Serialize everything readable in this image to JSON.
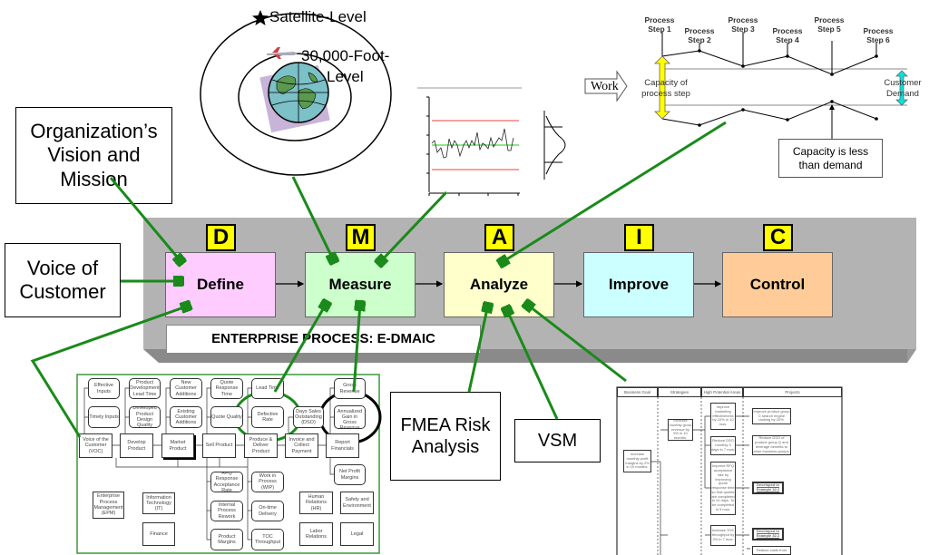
{
  "levels": {
    "satellite": "Satellite-Level",
    "foot_line1": "30,000-Foot-",
    "foot_line2": "Level"
  },
  "left_boxes": {
    "vision": "Organization’s Vision and Mission",
    "voice": "Voice of Customer"
  },
  "dmaic": {
    "phases": [
      {
        "letter": "D",
        "label": "Define",
        "color": "#ffccff"
      },
      {
        "letter": "M",
        "label": "Measure",
        "color": "#ccffcc"
      },
      {
        "letter": "A",
        "label": "Analyze",
        "color": "#ffffcc"
      },
      {
        "letter": "I",
        "label": "Improve",
        "color": "#ccffff"
      },
      {
        "letter": "C",
        "label": "Control",
        "color": "#ffcc99"
      }
    ],
    "banner": "ENTERPRISE PROCESS: E-DMAIC",
    "panel_color": "#b3b3b3"
  },
  "capacity": {
    "steps": [
      "Process Step 1",
      "Process Step 2",
      "Process Step 3",
      "Process Step 4",
      "Process Step 5",
      "Process Step 6"
    ],
    "work": "Work",
    "capacity_label": "Capacity of process step",
    "demand_label": "Customer Demand",
    "callout": "Capacity is less than demand"
  },
  "tools": {
    "fmea": "FMEA Risk Analysis",
    "vsm": "VSM"
  },
  "arrow_color": "#1a8a1a",
  "flowchart": {
    "boxes": [
      "Effective Inputs",
      "Timely Inputs",
      "Product Development Lead Time",
      "Developed Product Design Quality",
      "New Customer Additions",
      "Existing Customer Additions",
      "Quote Response Time",
      "Quote Quality",
      "Lead Time",
      "Defective Rate",
      "Days Sales Outstanding (DSO)",
      "Gross Revenue",
      "Percent Annualized Gain in Gross Revenue",
      "Voice of the Customer (VOC)",
      "Develop Product",
      "Market Product",
      "Sell Product",
      "Produce & Deliver Product",
      "Invoice and Collect Payment",
      "Report Financials",
      "Net Profit Margins",
      "RFQ Response Acceptance Rate",
      "Internal Process Rework",
      "Product Margins",
      "Work in Process (WIP)",
      "On-time Delivery",
      "TOC Throughput",
      "Enterprise Process Management (EPM)",
      "Information Technology (IT)",
      "Finance",
      "Human Relations (HR)",
      "Safety and Environment",
      "Labor Relations",
      "Legal"
    ]
  },
  "strategy_table": {
    "headers": [
      "Business Goal",
      "Strategies",
      "High Potential Areas",
      "Projects"
    ],
    "goal": "Increase monthly profit margins by 2% in 10 months.",
    "strategy": "Increase monthly gross revenue by 5% in 10 months.",
    "areas": [
      "Improve marketing effectiveness by 10% in 10 mos.",
      "Reduce DSO monthly 3 days in 7 mos.",
      "Improve RFQ acceptance rate by improving quote response time so that quotes are completed in 14 days. To be completed in 5 mos.",
      "Increase TOC throughput by 2% in 7 mos."
    ],
    "projects": [
      "Improve product group C search engine ranking by 20%.",
      "Reduce DSO of product group Q and leverage benefits to other business groups.",
      "Developed in Example 32.2",
      "Developed in Example 32.2",
      "Reduce costs from"
    ]
  }
}
